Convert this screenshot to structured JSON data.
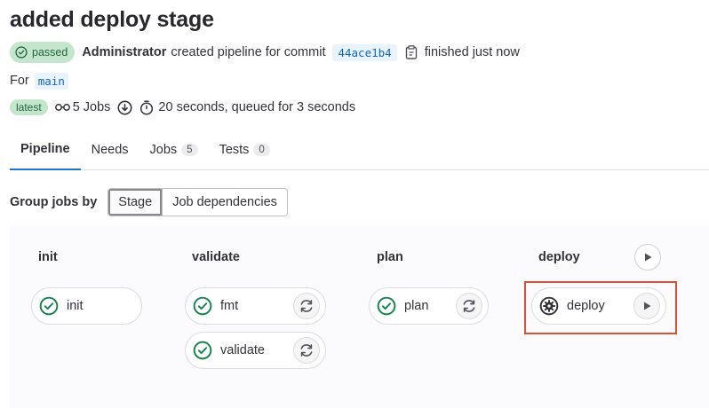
{
  "header": {
    "title": "added deploy stage",
    "status": "passed",
    "author": "Administrator",
    "created_text": "created pipeline for commit",
    "commit_sha": "44ace1b4",
    "finished_text": "finished just now",
    "for_label": "For",
    "branch": "main",
    "latest_badge": "latest",
    "jobs_count_text": "5 Jobs",
    "duration_text": "20 seconds, queued for 3 seconds"
  },
  "tabs": [
    {
      "label": "Pipeline",
      "count": null,
      "active": true
    },
    {
      "label": "Needs",
      "count": null,
      "active": false
    },
    {
      "label": "Jobs",
      "count": "5",
      "active": false
    },
    {
      "label": "Tests",
      "count": "0",
      "active": false
    }
  ],
  "group_by": {
    "label": "Group jobs by",
    "options": [
      "Stage",
      "Job dependencies"
    ],
    "selected": "Stage"
  },
  "pipeline": {
    "stages": [
      {
        "name": "init",
        "jobs": [
          {
            "name": "init",
            "status": "success",
            "action": null
          }
        ]
      },
      {
        "name": "validate",
        "jobs": [
          {
            "name": "fmt",
            "status": "success",
            "action": "retry"
          },
          {
            "name": "validate",
            "status": "success",
            "action": "retry"
          }
        ]
      },
      {
        "name": "plan",
        "jobs": [
          {
            "name": "plan",
            "status": "success",
            "action": "retry"
          }
        ]
      },
      {
        "name": "deploy",
        "stage_action": "play",
        "jobs": [
          {
            "name": "deploy",
            "status": "manual",
            "action": "play"
          }
        ]
      }
    ]
  },
  "colors": {
    "success": "#108548",
    "link": "#1068bf",
    "tab_active": "#1f75cb",
    "highlight": "#e04e34"
  }
}
